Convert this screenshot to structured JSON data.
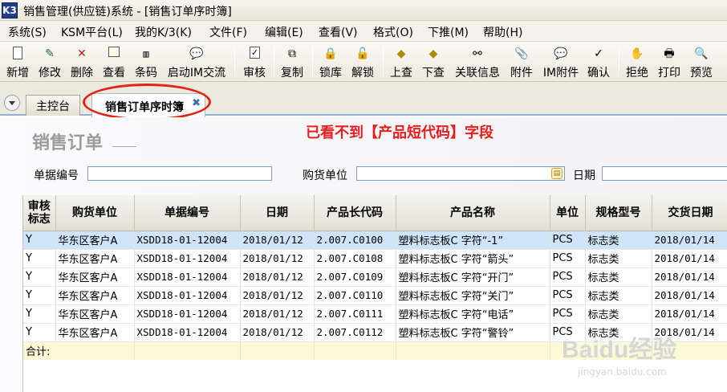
{
  "window": {
    "logo_text": "K3",
    "title": "销售管理(供应链)系统 - [销售订单序时簿]"
  },
  "menu": [
    "系统(S)",
    "KSM平台(L)",
    "我的K/3(K)",
    "文件(F)",
    "编辑(E)",
    "查看(V)",
    "格式(O)",
    "下推(M)",
    "帮助(H)"
  ],
  "toolbar": [
    {
      "label": "新增",
      "icon": "new-icon"
    },
    {
      "label": "修改",
      "icon": "edit-icon"
    },
    {
      "label": "删除",
      "icon": "delete-icon"
    },
    {
      "label": "查看",
      "icon": "view-icon"
    },
    {
      "label": "条码",
      "icon": "barcode-icon"
    },
    {
      "label": "启动IM交流",
      "icon": "chat-icon"
    },
    {
      "label": "审核",
      "icon": "audit-icon"
    },
    {
      "label": "复制",
      "icon": "copy-icon"
    },
    {
      "label": "锁库",
      "icon": "lock-icon"
    },
    {
      "label": "解锁",
      "icon": "unlock-icon"
    },
    {
      "label": "上查",
      "icon": "up-query-icon"
    },
    {
      "label": "下查",
      "icon": "down-query-icon"
    },
    {
      "label": "关联信息",
      "icon": "link-info-icon"
    },
    {
      "label": "附件",
      "icon": "attachment-icon"
    },
    {
      "label": "IM附件",
      "icon": "im-attachment-icon"
    },
    {
      "label": "确认",
      "icon": "confirm-icon"
    },
    {
      "label": "拒绝",
      "icon": "reject-icon"
    },
    {
      "label": "打印",
      "icon": "print-icon"
    },
    {
      "label": "预览",
      "icon": "preview-icon"
    }
  ],
  "tabs": {
    "main": "主控台",
    "active": "销售订单序时簿"
  },
  "content": {
    "page_title": "销售订单",
    "annotation": "已看不到【产品短代码】字段",
    "filters": {
      "bill_no_label": "单据编号",
      "buyer_label": "购货单位",
      "date_label": "日期"
    }
  },
  "grid": {
    "columns": [
      "审核\n标志",
      "购货单位",
      "单据编号",
      "日期",
      "产品长代码",
      "产品名称",
      "单位",
      "规格型号",
      "交货日期"
    ],
    "rows": [
      [
        "Y",
        "华东区客户A",
        "XSDD18-01-12004",
        "2018/01/12",
        "2.007.C0100",
        "塑料标志板C 字符“-1”",
        "PCS",
        "标志类",
        "2018/01/14"
      ],
      [
        "Y",
        "华东区客户A",
        "XSDD18-01-12004",
        "2018/01/12",
        "2.007.C0108",
        "塑料标志板C 字符“箭头”",
        "PCS",
        "标志类",
        "2018/01/14"
      ],
      [
        "Y",
        "华东区客户A",
        "XSDD18-01-12004",
        "2018/01/12",
        "2.007.C0109",
        "塑料标志板C 字符“开门”",
        "PCS",
        "标志类",
        "2018/01/14"
      ],
      [
        "Y",
        "华东区客户A",
        "XSDD18-01-12004",
        "2018/01/12",
        "2.007.C0110",
        "塑料标志板C 字符“关门”",
        "PCS",
        "标志类",
        "2018/01/14"
      ],
      [
        "Y",
        "华东区客户A",
        "XSDD18-01-12004",
        "2018/01/12",
        "2.007.C0111",
        "塑料标志板C 字符“电话”",
        "PCS",
        "标志类",
        "2018/01/14"
      ],
      [
        "Y",
        "华东区客户A",
        "XSDD18-01-12004",
        "2018/01/12",
        "2.007.C0112",
        "塑料标志板C 字符“警铃”",
        "PCS",
        "标志类",
        "2018/01/14"
      ]
    ],
    "total_label": "合计:"
  },
  "watermark": {
    "logo": "Baidu经验",
    "sub": "jingyan.baidu.com"
  },
  "colors": {
    "annotation": "#e81d1d",
    "selected_row": "#cfe4f9",
    "total_row": "#fcfad6"
  }
}
